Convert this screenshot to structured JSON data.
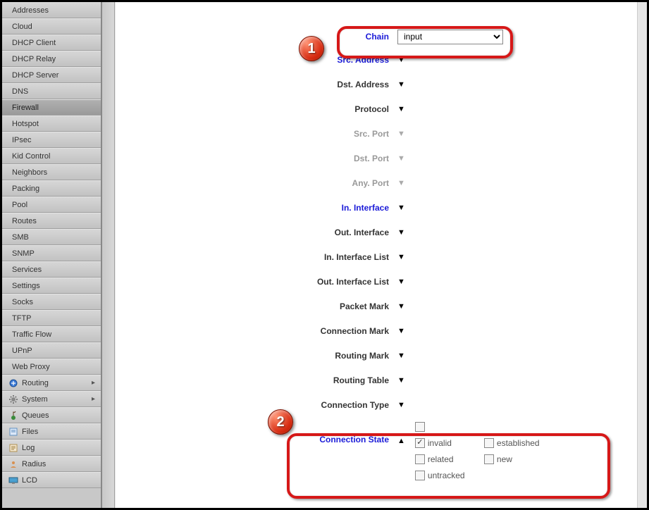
{
  "sidebar": {
    "sub_items": [
      "Addresses",
      "Cloud",
      "DHCP Client",
      "DHCP Relay",
      "DHCP Server",
      "DNS",
      "Firewall",
      "Hotspot",
      "IPsec",
      "Kid Control",
      "Neighbors",
      "Packing",
      "Pool",
      "Routes",
      "SMB",
      "SNMP",
      "Services",
      "Settings",
      "Socks",
      "TFTP",
      "Traffic Flow",
      "UPnP",
      "Web Proxy"
    ],
    "active_sub": "Firewall",
    "groups": [
      {
        "label": "Routing",
        "icon": "routing-icon",
        "expandable": true
      },
      {
        "label": "System",
        "icon": "gear-icon",
        "expandable": true
      },
      {
        "label": "Queues",
        "icon": "queues-icon",
        "expandable": false
      },
      {
        "label": "Files",
        "icon": "files-icon",
        "expandable": false
      },
      {
        "label": "Log",
        "icon": "log-icon",
        "expandable": false
      },
      {
        "label": "Radius",
        "icon": "radius-icon",
        "expandable": false
      },
      {
        "label": "LCD",
        "icon": "lcd-icon",
        "expandable": false
      }
    ]
  },
  "form": {
    "chain": {
      "label": "Chain",
      "value": "input"
    },
    "rows": [
      {
        "label": "Src. Address",
        "style": "link",
        "disabled": false
      },
      {
        "label": "Dst. Address",
        "style": "normal",
        "disabled": false
      },
      {
        "label": "Protocol",
        "style": "normal",
        "disabled": false
      },
      {
        "label": "Src. Port",
        "style": "disabled",
        "disabled": true
      },
      {
        "label": "Dst. Port",
        "style": "disabled",
        "disabled": true
      },
      {
        "label": "Any. Port",
        "style": "disabled",
        "disabled": true
      },
      {
        "label": "In. Interface",
        "style": "link",
        "disabled": false
      },
      {
        "label": "Out. Interface",
        "style": "normal",
        "disabled": false
      },
      {
        "label": "In. Interface List",
        "style": "normal",
        "disabled": false
      },
      {
        "label": "Out. Interface List",
        "style": "normal",
        "disabled": false
      },
      {
        "label": "Packet Mark",
        "style": "normal",
        "disabled": false
      },
      {
        "label": "Connection Mark",
        "style": "normal",
        "disabled": false
      },
      {
        "label": "Routing Mark",
        "style": "normal",
        "disabled": false
      },
      {
        "label": "Routing Table",
        "style": "normal",
        "disabled": false
      },
      {
        "label": "Connection Type",
        "style": "normal",
        "disabled": false
      }
    ],
    "conn_state": {
      "label": "Connection State",
      "options": [
        {
          "label": "invalid",
          "checked": true
        },
        {
          "label": "established",
          "checked": false
        },
        {
          "label": "related",
          "checked": false
        },
        {
          "label": "new",
          "checked": false
        },
        {
          "label": "untracked",
          "checked": false
        }
      ]
    }
  },
  "annotations": {
    "badge1": "1",
    "badge2": "2"
  }
}
